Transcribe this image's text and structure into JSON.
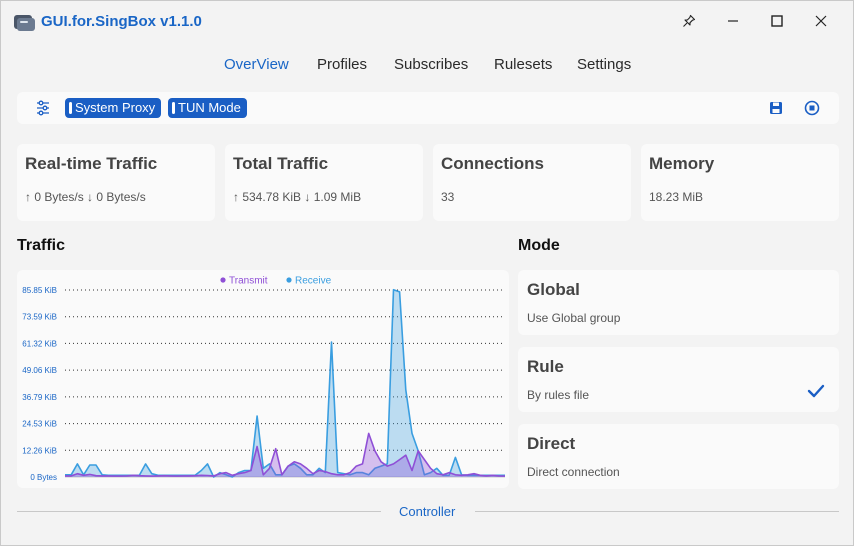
{
  "window": {
    "title": "GUI.for.SingBox v1.1.0"
  },
  "nav": {
    "tabs": [
      {
        "label": "OverView",
        "active": true
      },
      {
        "label": "Profiles",
        "active": false
      },
      {
        "label": "Subscribes",
        "active": false
      },
      {
        "label": "Rulesets",
        "active": false
      },
      {
        "label": "Settings",
        "active": false
      }
    ]
  },
  "toolbar": {
    "system_proxy": "System Proxy",
    "tun_mode": "TUN Mode"
  },
  "stats": [
    {
      "title": "Real-time Traffic",
      "value": "↑ 0 Bytes/s ↓ 0 Bytes/s"
    },
    {
      "title": "Total Traffic",
      "value": "↑ 534.78 KiB ↓ 1.09 MiB"
    },
    {
      "title": "Connections",
      "value": "33"
    },
    {
      "title": "Memory",
      "value": "18.23 MiB"
    }
  ],
  "traffic": {
    "heading": "Traffic"
  },
  "chart_data": {
    "type": "area",
    "legend_position": "top-center",
    "grid": true,
    "y_tick_labels": [
      "0 Bytes",
      "12.26 KiB",
      "24.53 KiB",
      "36.79 KiB",
      "49.06 KiB",
      "61.32 KiB",
      "73.59 KiB",
      "85.85 KiB"
    ],
    "ylim": [
      0,
      85.85
    ],
    "y_unit": "KiB",
    "series": [
      {
        "name": "Transmit",
        "color": "#8f4fd6",
        "values": [
          0.5,
          0.5,
          1.5,
          0.8,
          1.2,
          0.6,
          0.5,
          0.5,
          0.4,
          0.4,
          0.5,
          0.8,
          0.6,
          0.5,
          0.4,
          0.5,
          0.6,
          0.5,
          0.4,
          0.5,
          0.5,
          0.6,
          0.8,
          0.7,
          0.5,
          1.5,
          2,
          0.8,
          1.5,
          2,
          3,
          14,
          1,
          4,
          13,
          1,
          5,
          7,
          6,
          4,
          1.5,
          3,
          2.5,
          1.5,
          1,
          1,
          2,
          5,
          6,
          20,
          12,
          7,
          5,
          6,
          8,
          10,
          3,
          12,
          8,
          4,
          1.5,
          1,
          2,
          1,
          0.8,
          1,
          1.5,
          0.8,
          0.5,
          0.8,
          0.5,
          0.4
        ]
      },
      {
        "name": "Receive",
        "color": "#3a9ee0",
        "values": [
          1,
          1,
          6,
          1,
          5.5,
          5.5,
          1,
          0.8,
          0.8,
          0.8,
          0.8,
          0.8,
          0.8,
          6,
          1.5,
          0.8,
          0.8,
          0.8,
          0.8,
          0.8,
          0.8,
          0.8,
          3,
          6,
          0,
          2,
          1,
          0,
          2,
          3,
          3,
          28,
          4,
          6,
          1,
          1,
          5,
          6,
          4,
          1,
          1,
          4,
          2,
          62,
          2,
          1.5,
          1,
          2,
          2,
          1,
          4,
          5,
          6,
          86,
          85,
          40,
          20,
          12,
          1,
          2,
          4,
          0.8,
          0.8,
          9,
          1,
          0.8,
          0.8,
          0.8,
          0.8,
          0.8,
          0.8,
          0.8
        ]
      }
    ]
  },
  "mode": {
    "heading": "Mode",
    "options": [
      {
        "title": "Global",
        "desc": "Use Global group",
        "selected": false
      },
      {
        "title": "Rule",
        "desc": "By rules file",
        "selected": true
      },
      {
        "title": "Direct",
        "desc": "Direct connection",
        "selected": false
      }
    ]
  },
  "footer": {
    "controller": "Controller"
  },
  "colors": {
    "accent": "#1a66c6",
    "pill": "#1a5ec4",
    "transmit": "#8f4fd6",
    "receive": "#3a9ee0"
  }
}
